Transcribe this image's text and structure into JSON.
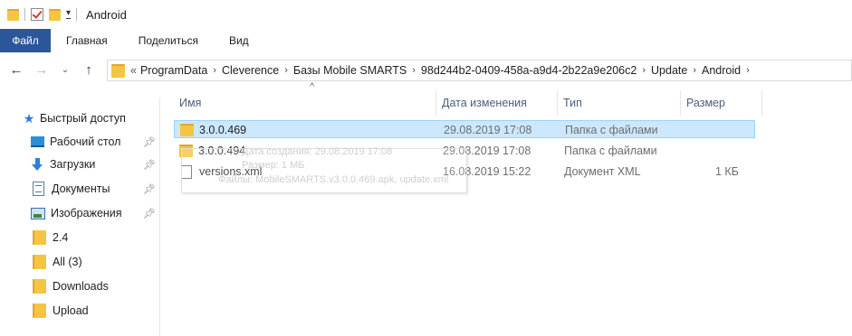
{
  "window": {
    "title": "Android"
  },
  "ribbon": {
    "file_tab": "Файл",
    "tabs": [
      "Главная",
      "Поделиться",
      "Вид"
    ]
  },
  "address_bar": {
    "overflow": "«",
    "crumbs": [
      "ProgramData",
      "Cleverence",
      "Базы Mobile SMARTS",
      "98d244b2-0409-458a-a9d4-2b22a9e206c2",
      "Update",
      "Android"
    ]
  },
  "sidebar": {
    "quick_access": "Быстрый доступ",
    "items": [
      {
        "label": "Рабочий стол",
        "icon": "desktop-icon",
        "pinned": true
      },
      {
        "label": "Загрузки",
        "icon": "downloads-icon",
        "pinned": true
      },
      {
        "label": "Документы",
        "icon": "documents-icon",
        "pinned": true
      },
      {
        "label": "Изображения",
        "icon": "pictures-icon",
        "pinned": true
      },
      {
        "label": "2.4",
        "icon": "folder-icon",
        "pinned": false
      },
      {
        "label": "All (3)",
        "icon": "folder-icon",
        "pinned": false
      },
      {
        "label": "Downloads",
        "icon": "folder-icon",
        "pinned": false
      },
      {
        "label": "Upload",
        "icon": "folder-icon",
        "pinned": false
      }
    ]
  },
  "file_list": {
    "columns": [
      "Имя",
      "Дата изменения",
      "Тип",
      "Размер"
    ],
    "rows": [
      {
        "name": "3.0.0.469",
        "date": "29.08.2019 17:08",
        "type": "Папка с файлами",
        "size": "",
        "selected": true
      },
      {
        "name": "3.0.0.494",
        "date": "29.08.2019 17:08",
        "type": "Папка с файлами",
        "size": "",
        "selected": false
      },
      {
        "name": "versions.xml",
        "date": "16.08.2019 15:22",
        "type": "Документ XML",
        "size": "1 КБ",
        "selected": false
      }
    ],
    "tooltip": {
      "line1": "Дата создания: 29.08.2019 17:08",
      "line2": "Размер: 1 МБ",
      "line3": "Файлы: MobileSMARTS.v3.0.0.469.apk, update.xml"
    }
  }
}
